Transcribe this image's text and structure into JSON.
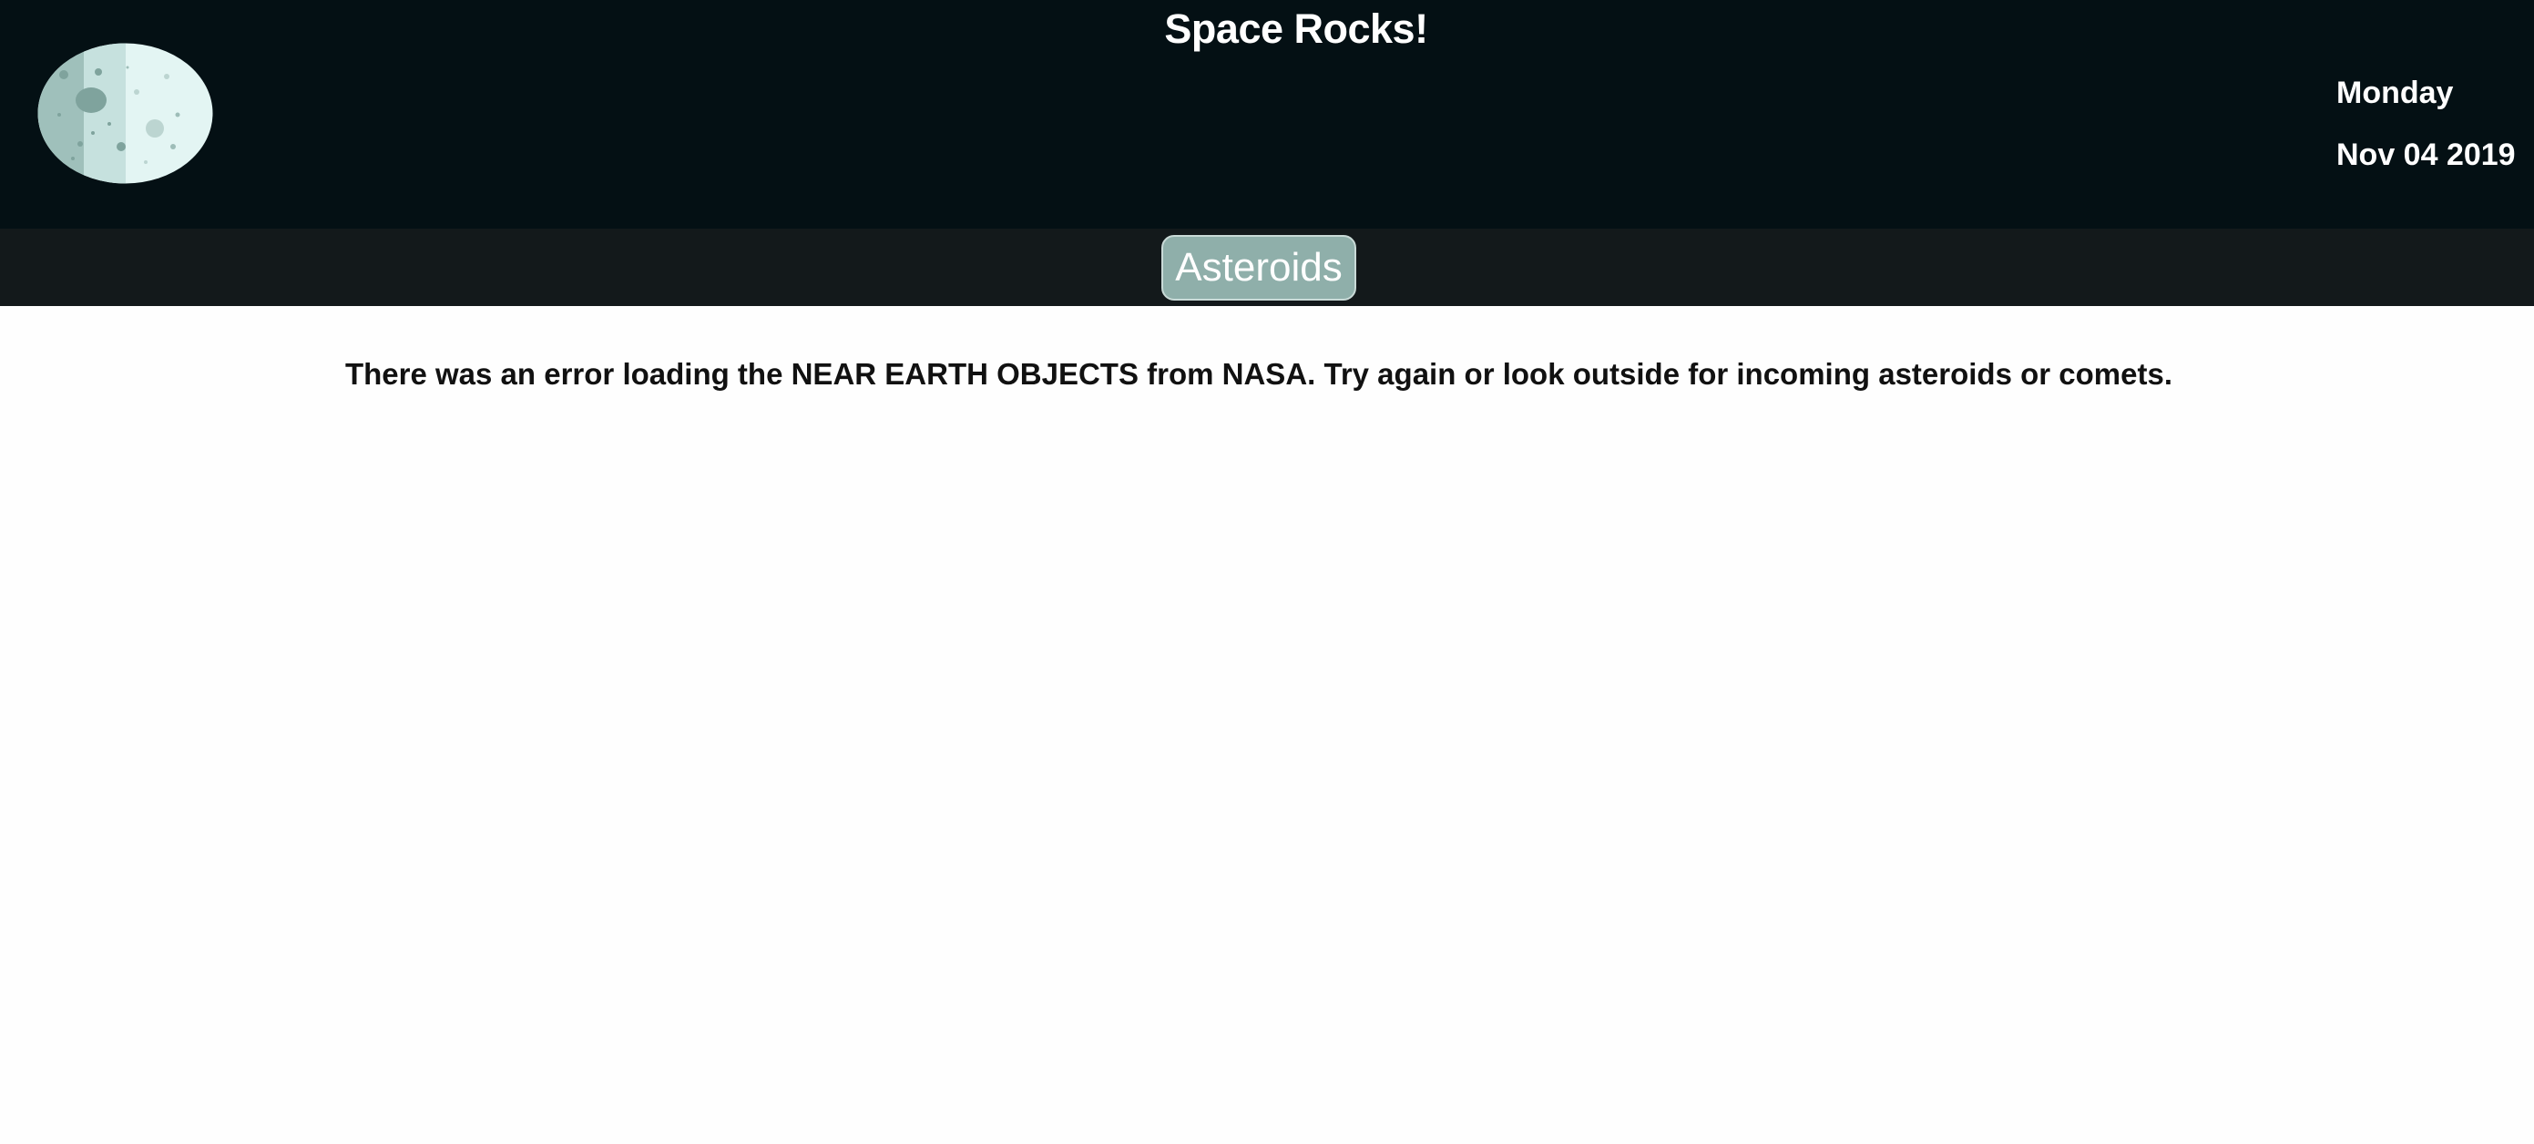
{
  "header": {
    "title": "Space Rocks!",
    "logo_icon": "moon-icon",
    "day": "Monday",
    "date": "Nov 04 2019"
  },
  "nav": {
    "asteroids_label": "Asteroids"
  },
  "main": {
    "error_message": "There was an error loading the NEAR EARTH OBJECTS from NASA. Try again or look outside for incoming asteroids or comets."
  },
  "colors": {
    "header_bg": "#041014",
    "nav_bg": "#13191b",
    "button_bg": "#8fafaa",
    "page_bg": "#fefefe"
  }
}
